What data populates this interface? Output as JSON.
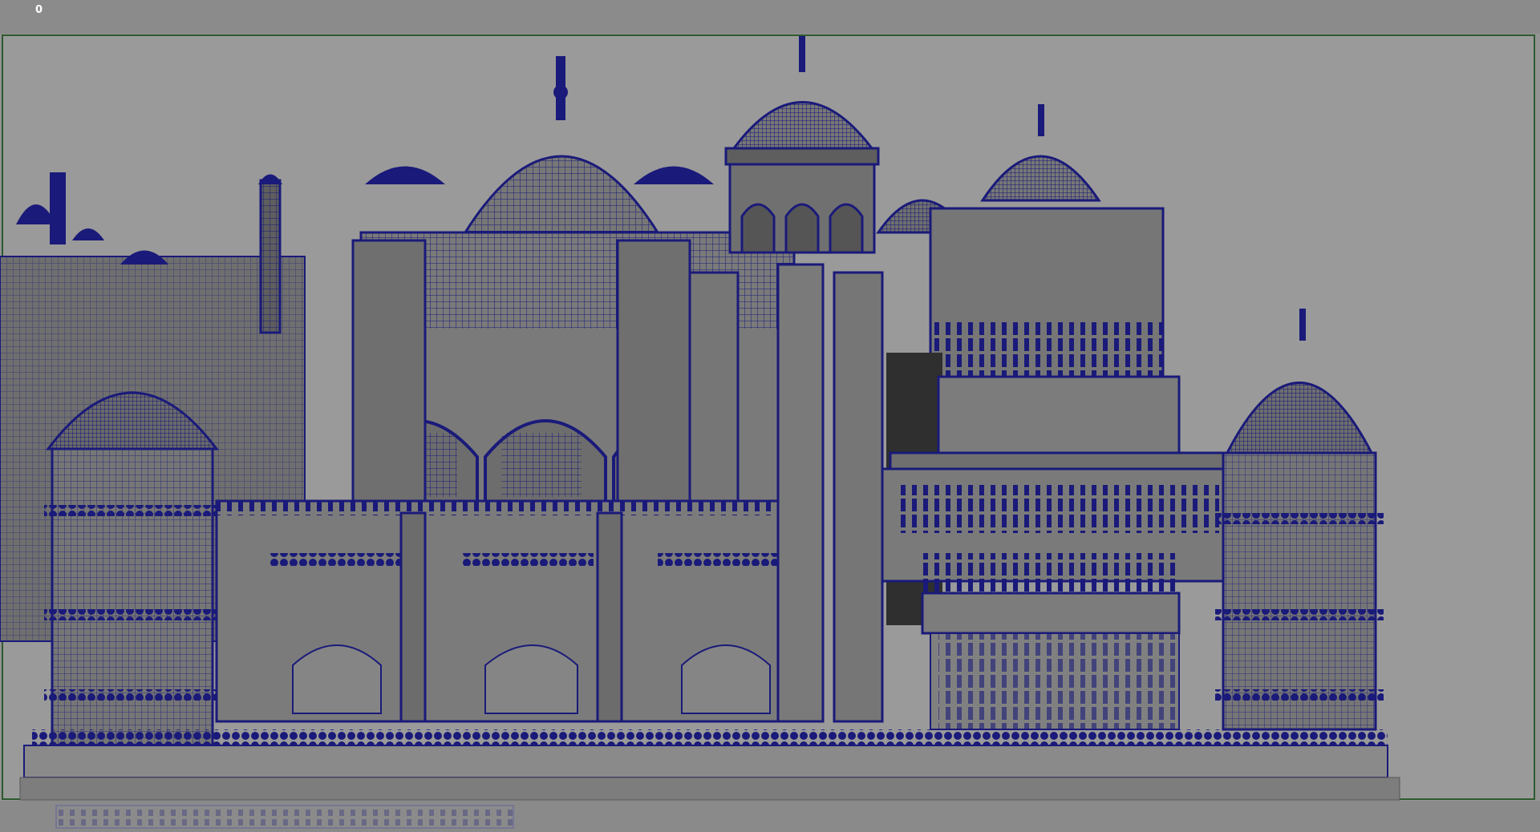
{
  "viewport": {
    "frame_counter": "0"
  },
  "colors": {
    "background": "#949494",
    "gate_border": "#2e5a2e",
    "wireframe": "#1a1a7a",
    "surface": "#7d7d7d",
    "shadow": "#3a3a3a"
  },
  "scene": {
    "subject": "palace-wireframe-model"
  }
}
